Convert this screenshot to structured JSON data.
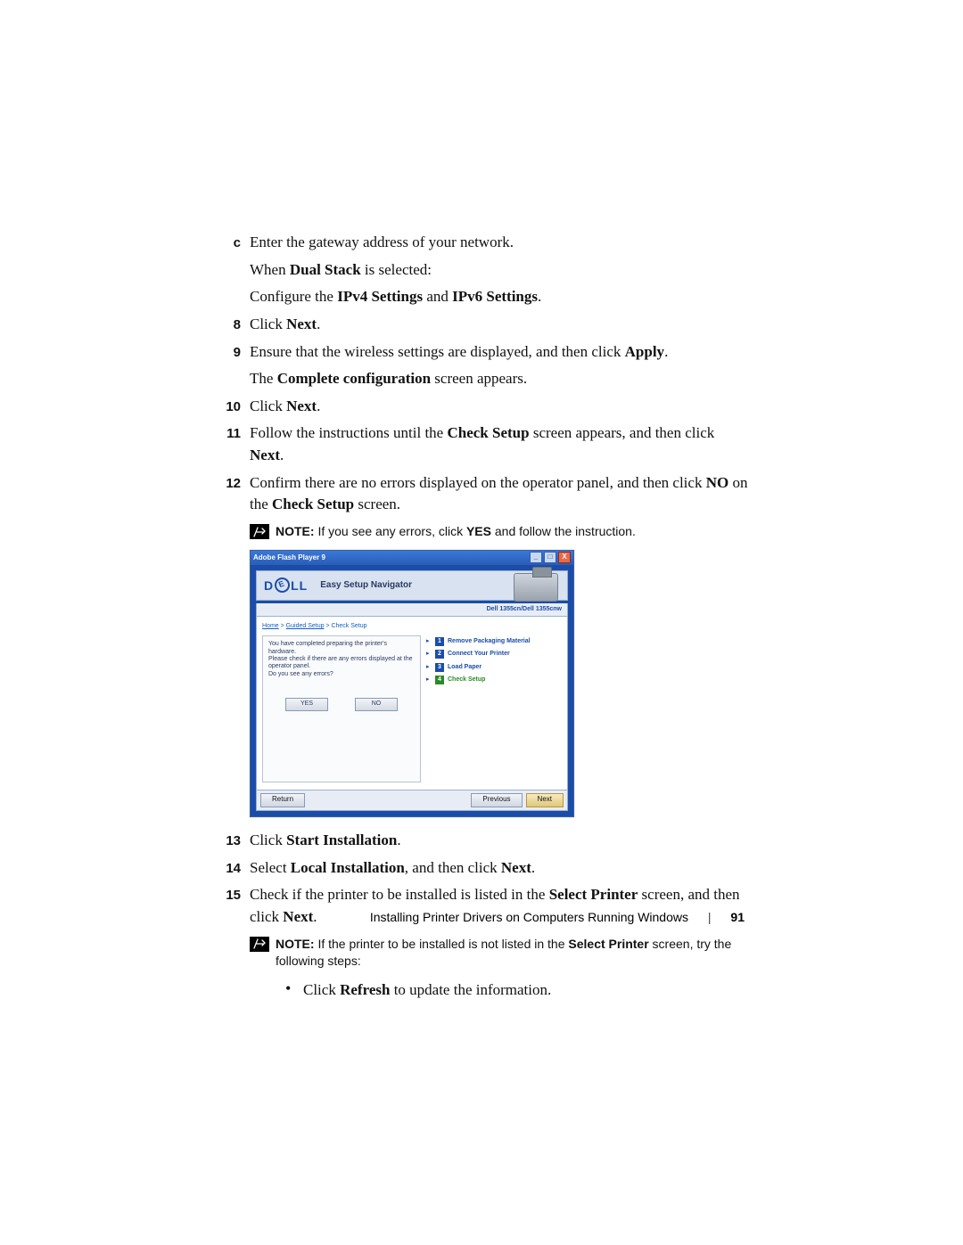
{
  "list": {
    "c": {
      "label": "c",
      "text": "Enter the gateway address of your network."
    },
    "dual_line": {
      "pre": "When ",
      "b1": "Dual Stack",
      "post": " is selected:"
    },
    "configure": {
      "pre": "Configure the ",
      "b1": "IPv4 Settings",
      "mid": " and ",
      "b2": "IPv6 Settings",
      "post": "."
    },
    "8": {
      "label": "8",
      "pre": "Click ",
      "b1": "Next",
      "post": "."
    },
    "9": {
      "label": "9",
      "pre": "Ensure that the wireless settings are displayed, and then click ",
      "b1": "Apply",
      "post": "."
    },
    "9b": {
      "pre": "The ",
      "b1": "Complete configuration",
      "post": " screen appears."
    },
    "10": {
      "label": "10",
      "pre": "Click ",
      "b1": "Next",
      "post": "."
    },
    "11": {
      "label": "11",
      "pre": "Follow the instructions until the ",
      "b1": "Check Setup",
      "mid": " screen appears, and then click ",
      "b2": "Next",
      "post": "."
    },
    "12": {
      "label": "12",
      "pre": "Confirm there are no errors displayed on the operator panel, and then click ",
      "b1": "NO",
      "mid": " on the ",
      "b2": "Check Setup",
      "post": " screen."
    },
    "13": {
      "label": "13",
      "pre": "Click ",
      "b1": "Start Installation",
      "post": "."
    },
    "14": {
      "label": "14",
      "pre": "Select ",
      "b1": "Local Installation",
      "mid": ", and then click ",
      "b2": "Next",
      "post": "."
    },
    "15": {
      "label": "15",
      "pre": "Check if the printer to be installed is listed in the ",
      "b1": "Select Printer",
      "mid": " screen, and then click ",
      "b2": "Next",
      "post": "."
    }
  },
  "note1": {
    "label": "NOTE:",
    "pre": " If you see any errors, click ",
    "b1": "YES",
    "post": " and follow the instruction."
  },
  "note2": {
    "label": "NOTE:",
    "pre": " If the printer to be installed is not listed in the ",
    "b1": "Select Printer",
    "post": " screen, try the following steps:"
  },
  "bullet": {
    "pre": "Click ",
    "b1": "Refresh",
    "post": " to update the information."
  },
  "window": {
    "title": "Adobe Flash Player 9",
    "brand": "DELL",
    "nav_title": "Easy Setup Navigator",
    "model": "Dell 1355cn/Dell 1355cnw",
    "crumb1": "Home",
    "crumb2": "Guided Setup",
    "crumb3": "Check Setup",
    "msg1": "You have completed preparing the printer's hardware.",
    "msg2": "Please check if there are any errors displayed at the operator panel.",
    "msg3": "Do you see any errors?",
    "yes": "YES",
    "no": "NO",
    "steps": [
      {
        "num": "1",
        "label": "Remove Packaging Material"
      },
      {
        "num": "2",
        "label": "Connect Your Printer"
      },
      {
        "num": "3",
        "label": "Load Paper"
      },
      {
        "num": "4",
        "label": "Check Setup"
      }
    ],
    "return": "Return",
    "previous": "Previous",
    "next": "Next",
    "min": "_",
    "max": "□",
    "close": "X"
  },
  "footer": {
    "title": "Installing Printer Drivers on Computers Running Windows",
    "page": "91"
  }
}
